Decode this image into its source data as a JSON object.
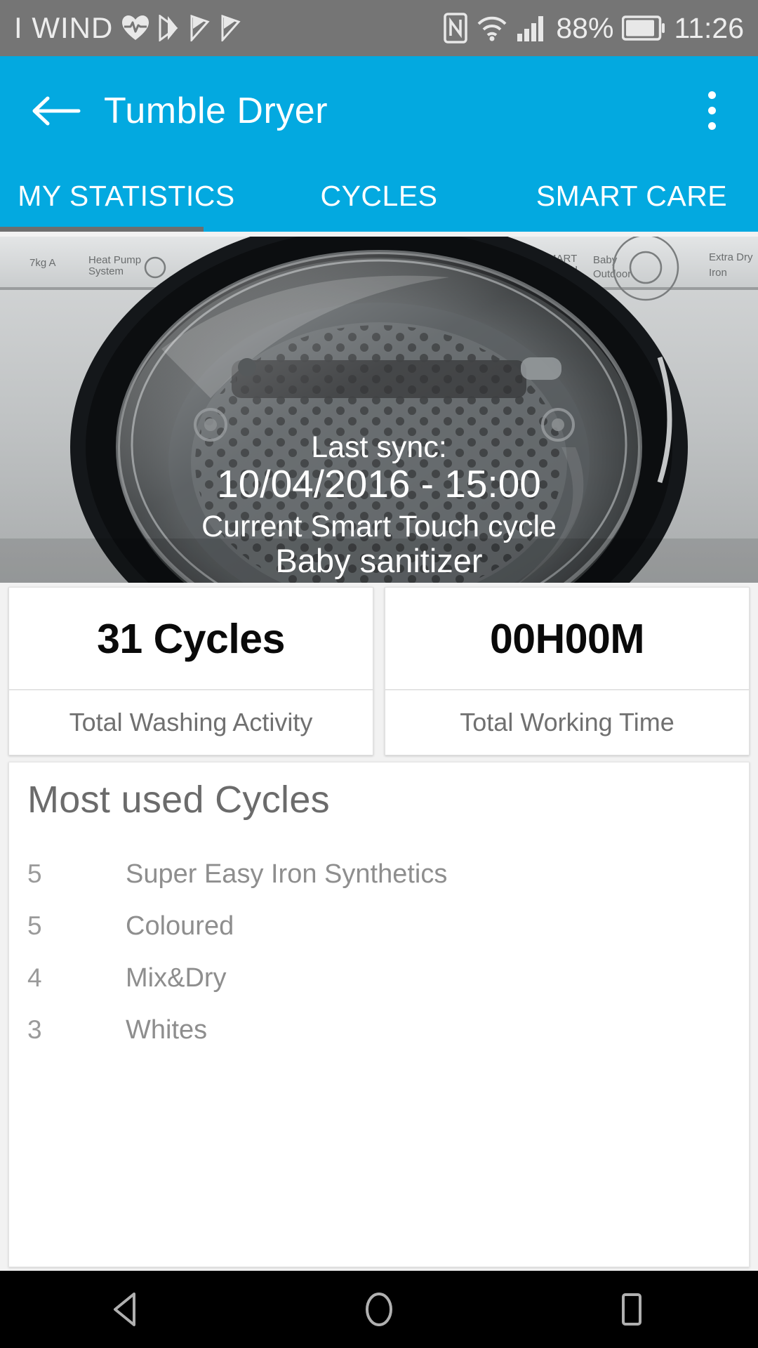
{
  "status_bar": {
    "carrier": "I WIND",
    "battery_percent": "88%",
    "time": "11:26",
    "icons": [
      "heart-rate-icon",
      "media-play-icon",
      "media-play-icon-2",
      "media-play-icon-3",
      "nfc-icon",
      "wifi-icon",
      "signal-bars-icon",
      "battery-icon"
    ]
  },
  "appbar": {
    "back_icon": "back-arrow-icon",
    "title": "Tumble Dryer",
    "overflow_icon": "overflow-menu-icon"
  },
  "tabs": {
    "items": [
      {
        "label": "MY STATISTICS",
        "selected": true
      },
      {
        "label": "CYCLES",
        "selected": false
      },
      {
        "label": "SMART CARE",
        "selected": false
      }
    ],
    "indicator_color": "#6e6e6e"
  },
  "hero": {
    "image_name": "tumble-dryer-photo",
    "last_sync_label": "Last sync:",
    "last_sync_value": "10/04/2016 - 15:00",
    "current_cycle_label": "Current Smart Touch cycle",
    "current_cycle_value": "Baby sanitizer"
  },
  "stats": [
    {
      "value": "31 Cycles",
      "label": "Total Washing Activity"
    },
    {
      "value": "00H00M",
      "label": "Total Working Time"
    }
  ],
  "most_used_cycles": {
    "title": "Most used Cycles",
    "rows": [
      {
        "count": "5",
        "name": "Super Easy Iron Synthetics"
      },
      {
        "count": "5",
        "name": "Coloured"
      },
      {
        "count": "4",
        "name": "Mix&Dry"
      },
      {
        "count": "3",
        "name": "Whites"
      }
    ]
  },
  "navbar": {
    "back_label": "back-triangle-icon",
    "home_label": "home-circle-icon",
    "recents_label": "recents-square-icon"
  },
  "colors": {
    "accent": "#03a9e0",
    "statusbar": "#757575",
    "navbar": "#000000",
    "text_muted": "#8e8e8e"
  }
}
